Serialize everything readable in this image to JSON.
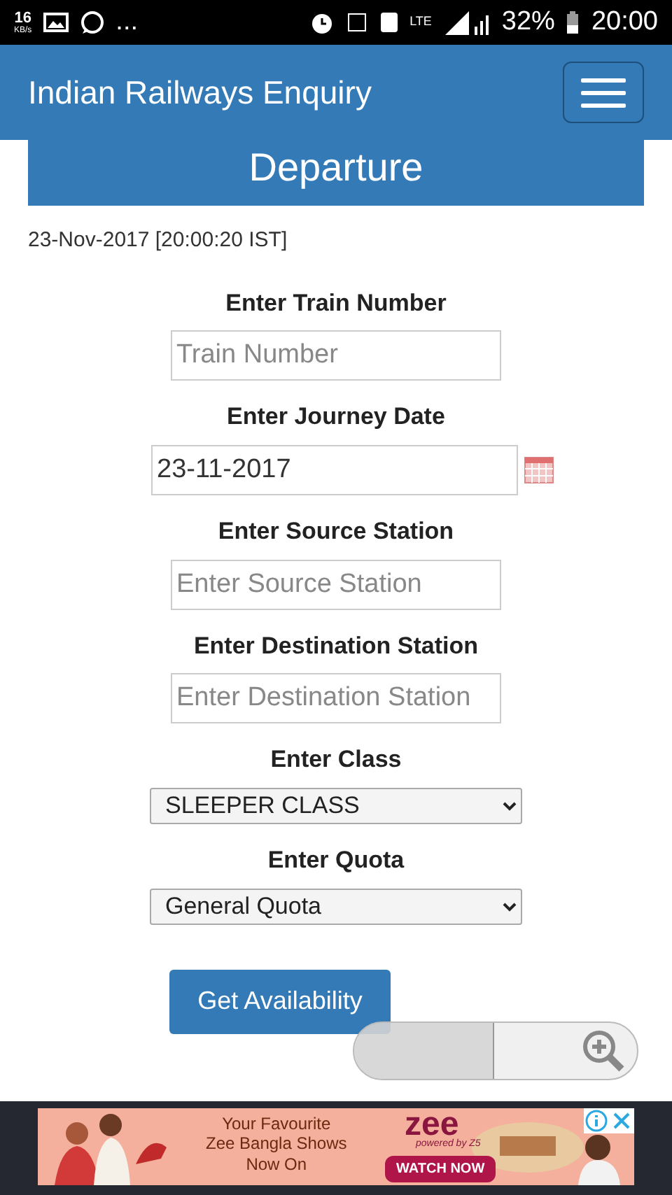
{
  "status_bar": {
    "speed": "16",
    "speed_unit": "KB/s",
    "more": "...",
    "network": "LTE",
    "battery": "32%",
    "time": "20:00"
  },
  "navbar": {
    "title": "Indian Railways Enquiry"
  },
  "panel": {
    "title": "Departure"
  },
  "timestamp": "23-Nov-2017 [20:00:20 IST]",
  "form": [
    {
      "kind": "text",
      "label": "Enter Train Number",
      "placeholder": "Train Number"
    },
    {
      "kind": "date",
      "label": "Enter Journey Date",
      "value": "23-11-2017"
    },
    {
      "kind": "text",
      "label": "Enter Source Station",
      "placeholder": "Enter Source Station"
    },
    {
      "kind": "text",
      "label": "Enter Destination Station",
      "placeholder": "Enter Destination Station"
    },
    {
      "kind": "select",
      "label": "Enter Class",
      "value": "SLEEPER CLASS"
    },
    {
      "kind": "select",
      "label": "Enter Quota",
      "value": "General Quota"
    }
  ],
  "submit": "Get Availability",
  "ad": {
    "line_1": "Your Favourite",
    "line_2": "Zee Bangla Shows",
    "line_3": "Now On",
    "brand": "zee",
    "tagline": "powered by Z5",
    "cta": "WATCH NOW"
  }
}
